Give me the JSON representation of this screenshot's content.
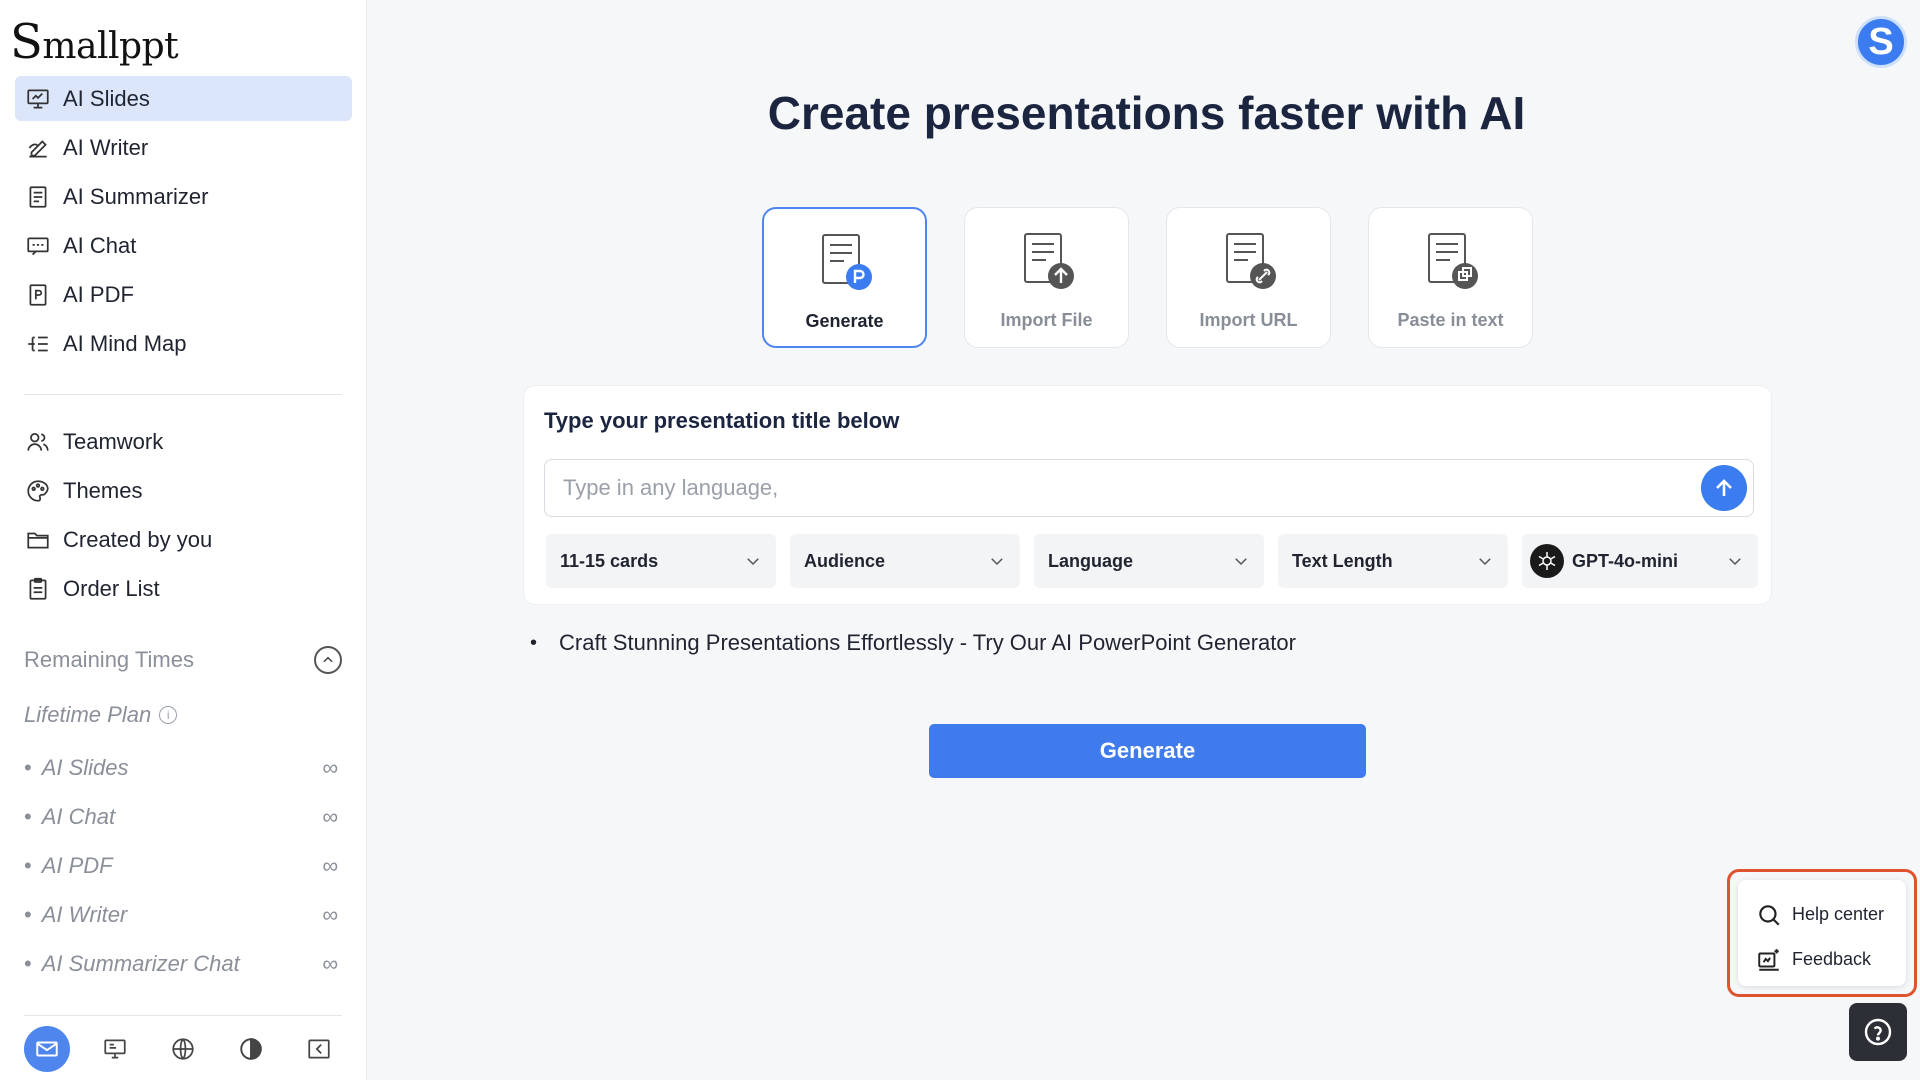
{
  "brand": {
    "logo_text": "Smallppt",
    "logo_first": "S",
    "logo_rest": "mallppt"
  },
  "sidebar": {
    "primary": [
      {
        "label": "AI Slides",
        "icon": "presentation-icon",
        "active": true
      },
      {
        "label": "AI Writer",
        "icon": "pen-icon"
      },
      {
        "label": "AI Summarizer",
        "icon": "document-icon"
      },
      {
        "label": "AI Chat",
        "icon": "chat-icon"
      },
      {
        "label": "AI PDF",
        "icon": "pdf-icon"
      },
      {
        "label": "AI Mind Map",
        "icon": "mindmap-icon"
      }
    ],
    "secondary": [
      {
        "label": "Teamwork",
        "icon": "users-icon"
      },
      {
        "label": "Themes",
        "icon": "palette-icon"
      },
      {
        "label": "Created by you",
        "icon": "folder-icon"
      },
      {
        "label": "Order List",
        "icon": "clipboard-icon"
      }
    ],
    "remaining_label": "Remaining Times",
    "plan_label": "Lifetime Plan",
    "quota": [
      {
        "label": "AI Slides",
        "value": "∞"
      },
      {
        "label": "AI Chat",
        "value": "∞"
      },
      {
        "label": "AI PDF",
        "value": "∞"
      },
      {
        "label": "AI Writer",
        "value": "∞"
      },
      {
        "label": "AI Summarizer Chat",
        "value": "∞"
      }
    ]
  },
  "header": {
    "avatar_letter": "S"
  },
  "main": {
    "title": "Create presentations faster with AI",
    "modes": [
      {
        "label": "Generate",
        "selected": true
      },
      {
        "label": "Import File"
      },
      {
        "label": "Import URL"
      },
      {
        "label": "Paste in text"
      }
    ],
    "panel_label": "Type your presentation title below",
    "input_placeholder": "Type in any language,",
    "selects": {
      "cards": "11-15 cards",
      "audience": "Audience",
      "language": "Language",
      "text_length": "Text Length",
      "model": "GPT-4o-mini"
    },
    "tip": "Craft Stunning Presentations Effortlessly - Try Our AI PowerPoint Generator",
    "generate_label": "Generate"
  },
  "help": {
    "help_center": "Help center",
    "feedback": "Feedback"
  },
  "colors": {
    "accent": "#3f7bec",
    "active_bg": "#dbe6fb",
    "highlight": "#e0532f"
  }
}
